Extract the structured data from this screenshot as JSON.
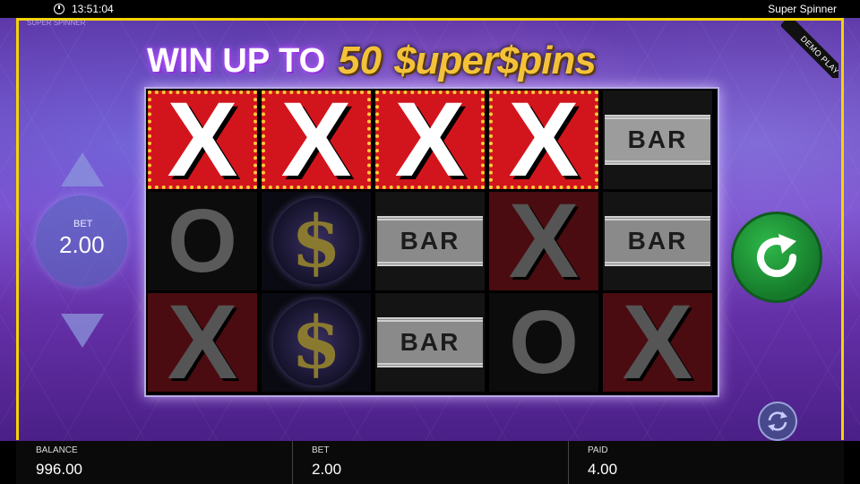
{
  "status_bar": {
    "time": "13:51:04",
    "game_title": "Super Spinner"
  },
  "stage": {
    "subtitle": "SUPER SPINNER",
    "demo_label": "DEMO PLAY"
  },
  "headline": {
    "prefix": "WIN UP TO",
    "amount": "50",
    "brand": "$uper$pins"
  },
  "reels": {
    "columns": [
      [
        "X",
        "O",
        "X"
      ],
      [
        "X",
        "$",
        "$"
      ],
      [
        "X",
        "BAR",
        "BAR"
      ],
      [
        "X",
        "X",
        "O"
      ],
      [
        "BAR",
        "BAR",
        "X"
      ]
    ],
    "highlighted_row": 0,
    "highlighted_reels": 4
  },
  "bet_control": {
    "label": "BET",
    "value": "2.00"
  },
  "icons": {
    "clock": "clock-icon",
    "spin": "refresh-arrow-icon",
    "autoplay": "autoplay-arrows-icon",
    "increase": "arrow-up-icon",
    "decrease": "arrow-down-icon"
  },
  "colors": {
    "frame": "#f5d400",
    "spin_button": "#2fb84a",
    "win_cell": "#d2151c"
  },
  "footer": {
    "balance_label": "BALANCE",
    "balance_value": "996.00",
    "bet_label": "BET",
    "bet_value": "2.00",
    "paid_label": "PAID",
    "paid_value": "4.00"
  }
}
